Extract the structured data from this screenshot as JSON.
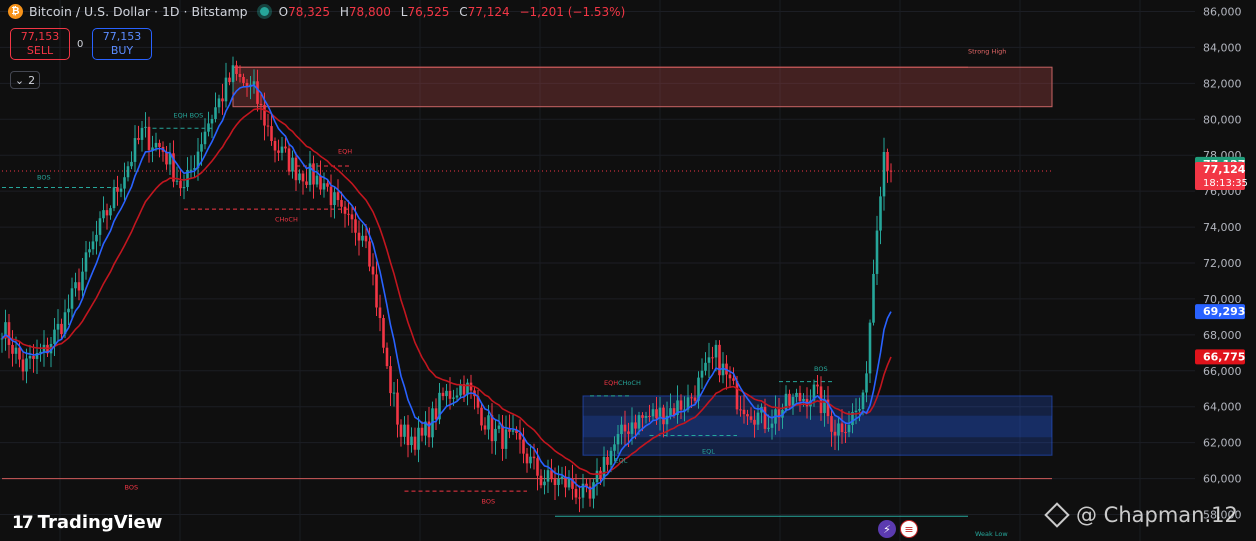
{
  "header": {
    "symbol_icon": "bitcoin-icon",
    "title": "Bitcoin / U.S. Dollar · 1D · Bitstamp",
    "ohlc": [
      {
        "k": "O",
        "v": "78,325"
      },
      {
        "k": "H",
        "v": "78,800"
      },
      {
        "k": "L",
        "v": "76,525"
      },
      {
        "k": "C",
        "v": "77,124"
      }
    ],
    "change": "−1,201 (−1.53%)"
  },
  "trade": {
    "sell_price": "77,153",
    "sell_label": "SELL",
    "buy_price": "77,153",
    "buy_label": "BUY",
    "spread": "0"
  },
  "indicators_toggle": "2",
  "branding": {
    "logo_text": "TradingView",
    "watermark": "@ Chapman.12"
  },
  "colors": {
    "up": "#26a69a",
    "down": "#f23645",
    "ema_fast": "#2962ff",
    "ema_slow": "#c2161f",
    "background": "#0f0f0f"
  },
  "chart_data": {
    "type": "candlestick",
    "ylim": [
      57000,
      86500
    ],
    "yticks": [
      58000,
      60000,
      62000,
      64000,
      66000,
      68000,
      70000,
      72000,
      74000,
      76000,
      78000,
      80000,
      82000,
      84000,
      86000
    ],
    "ytick_labels": [
      "58,000",
      "60,000",
      "62,000",
      "64,000",
      "66,000",
      "68,000",
      "70,000",
      "72,000",
      "74,000",
      "76,000",
      "78,000",
      "80,000",
      "82,000",
      "84,000",
      "86,000"
    ],
    "segments": [
      [
        0,
        68500
      ],
      [
        6,
        66200
      ],
      [
        12,
        67000
      ],
      [
        18,
        69000
      ],
      [
        26,
        73000
      ],
      [
        33,
        76200
      ],
      [
        40,
        79200
      ],
      [
        46,
        78300
      ],
      [
        52,
        76000
      ],
      [
        58,
        79500
      ],
      [
        66,
        82500
      ],
      [
        72,
        81500
      ],
      [
        78,
        78500
      ],
      [
        84,
        77200
      ],
      [
        92,
        76500
      ],
      [
        98,
        74200
      ],
      [
        104,
        73800
      ],
      [
        110,
        66000
      ],
      [
        114,
        62500
      ],
      [
        120,
        62200
      ],
      [
        126,
        64500
      ],
      [
        132,
        65300
      ],
      [
        140,
        62600
      ],
      [
        148,
        61800
      ],
      [
        154,
        60000
      ],
      [
        162,
        59700
      ],
      [
        168,
        58700
      ],
      [
        172,
        61000
      ],
      [
        180,
        63200
      ],
      [
        188,
        63600
      ],
      [
        196,
        64300
      ],
      [
        204,
        66800
      ],
      [
        210,
        64500
      ],
      [
        218,
        63200
      ],
      [
        226,
        64300
      ],
      [
        232,
        64800
      ],
      [
        238,
        62800
      ],
      [
        242,
        63300
      ],
      [
        246,
        64100
      ],
      [
        248,
        68800
      ],
      [
        250,
        74500
      ],
      [
        252,
        78300
      ],
      [
        254,
        77124
      ]
    ],
    "candle_count": 255,
    "ema_fast_end": 69293,
    "ema_slow_end": 66775,
    "price_labels": [
      {
        "value": 77127,
        "text": "77,127",
        "color": "#1f9c7a"
      },
      {
        "value": 77124,
        "text": "77,124",
        "sub": "18:13:35",
        "color": "#f23645"
      },
      {
        "value": 69293,
        "text": "69,293",
        "color": "#2962ff"
      },
      {
        "value": 66775,
        "text": "66,775",
        "color": "#e0131b"
      }
    ],
    "zones": [
      {
        "i0": 66,
        "i1": 300,
        "y0": 80700,
        "y1": 82900,
        "fill": "rgba(178,70,70,0.32)",
        "stroke": "#c86464"
      },
      {
        "i0": 166,
        "i1": 300,
        "y0": 61300,
        "y1": 64600,
        "fill": "rgba(41,98,255,0.22)",
        "stroke": "rgba(41,98,255,0.5)"
      },
      {
        "i0": 166,
        "i1": 300,
        "y0": 62300,
        "y1": 63500,
        "fill": "rgba(41,98,255,0.18)",
        "stroke": "none"
      }
    ],
    "levels": [
      {
        "i0": 66,
        "i1": 276,
        "y": 82900,
        "color": "#d05a5a",
        "dash": false
      },
      {
        "i0": 0,
        "i1": 300,
        "y": 60000,
        "color": "#d05a5a",
        "dash": false
      },
      {
        "i0": 0,
        "i1": 300,
        "y": 77124,
        "color": "#f23645",
        "dash": "1,3"
      },
      {
        "i0": 0,
        "i1": 33,
        "y": 76200,
        "color": "#26a69a",
        "dash": "4,3"
      },
      {
        "i0": 43,
        "i1": 60,
        "y": 79500,
        "color": "#26a69a",
        "dash": "4,3"
      },
      {
        "i0": 52,
        "i1": 102,
        "y": 75000,
        "color": "#f23645",
        "dash": "4,3"
      },
      {
        "i0": 84,
        "i1": 100,
        "y": 77400,
        "color": "#f23645",
        "dash": "4,3"
      },
      {
        "i0": 115,
        "i1": 150,
        "y": 59300,
        "color": "#f23645",
        "dash": "4,3"
      },
      {
        "i0": 222,
        "i1": 238,
        "y": 65400,
        "color": "#26a69a",
        "dash": "4,3"
      },
      {
        "i0": 158,
        "i1": 276,
        "y": 57900,
        "color": "#26a69a",
        "dash": false
      },
      {
        "i0": 168,
        "i1": 180,
        "y": 64600,
        "color": "#26a69a",
        "dash": "4,3"
      },
      {
        "i0": 185,
        "i1": 210,
        "y": 62400,
        "color": "#26a69a",
        "dash": "4,3"
      }
    ],
    "annotations": [
      {
        "i": 276,
        "y": 83650,
        "text": "Strong High",
        "color": "#e06666"
      },
      {
        "i": 10,
        "y": 76650,
        "text": "BOS",
        "color": "#26a69a"
      },
      {
        "i": 49,
        "y": 80100,
        "text": "EQH BOS",
        "color": "#26a69a"
      },
      {
        "i": 96,
        "y": 78100,
        "text": "EQH",
        "color": "#f23645"
      },
      {
        "i": 78,
        "y": 74300,
        "text": "CHoCH",
        "color": "#f23645"
      },
      {
        "i": 35,
        "y": 59400,
        "text": "BOS",
        "color": "#f23645"
      },
      {
        "i": 137,
        "y": 58600,
        "text": "BOS",
        "color": "#f23645"
      },
      {
        "i": 172,
        "y": 65200,
        "text": "EQH",
        "color": "#f23645"
      },
      {
        "i": 176,
        "y": 65200,
        "text": "CHoCH",
        "color": "#26a69a"
      },
      {
        "i": 175,
        "y": 60900,
        "text": "EQL",
        "color": "#26a69a"
      },
      {
        "i": 200,
        "y": 61400,
        "text": "EQL",
        "color": "#26a69a"
      },
      {
        "i": 232,
        "y": 66000,
        "text": "BOS",
        "color": "#26a69a"
      },
      {
        "i": 278,
        "y": 56800,
        "text": "Weak Low",
        "color": "#26a69a"
      }
    ]
  }
}
